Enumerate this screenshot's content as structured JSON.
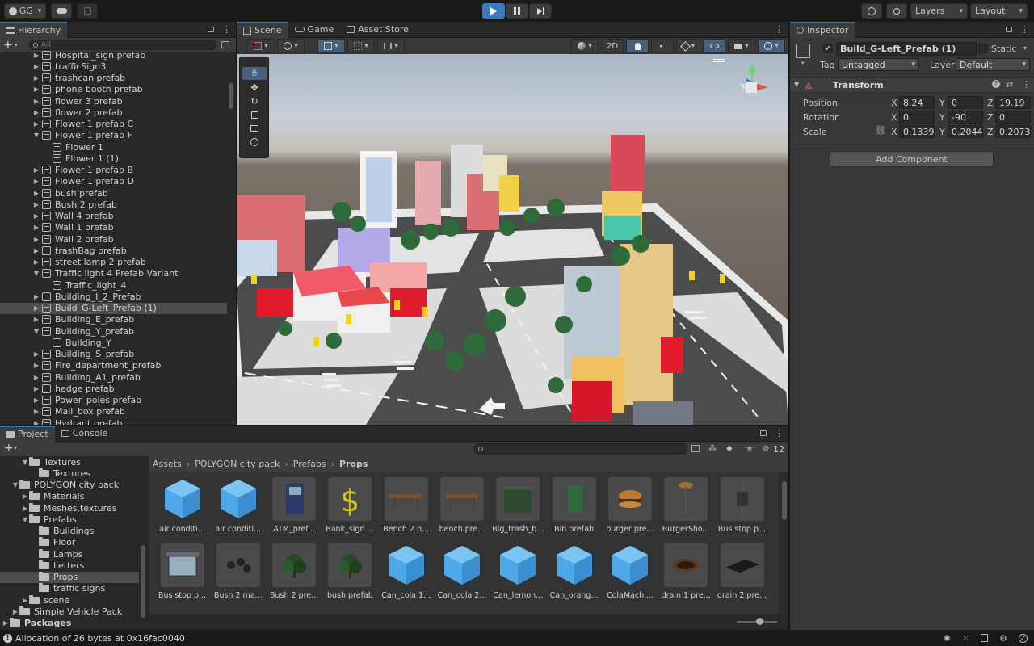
{
  "toolbar": {
    "account": "GG",
    "layers_label": "Layers",
    "layout_label": "Layout"
  },
  "hierarchy": {
    "tab": "Hierarchy",
    "search_placeholder": "All",
    "items": [
      {
        "label": "Hospital_sign prefab",
        "indent": 0,
        "arrow": "▶"
      },
      {
        "label": "trafficSign3",
        "indent": 0,
        "arrow": "▶"
      },
      {
        "label": "trashcan prefab",
        "indent": 0,
        "arrow": "▶"
      },
      {
        "label": "phone booth prefab",
        "indent": 0,
        "arrow": "▶"
      },
      {
        "label": "flower 3 prefab",
        "indent": 0,
        "arrow": "▶"
      },
      {
        "label": "flower 2 prefab",
        "indent": 0,
        "arrow": "▶"
      },
      {
        "label": "Flower 1 prefab C",
        "indent": 0,
        "arrow": "▶"
      },
      {
        "label": "Flower 1 prefab F",
        "indent": 0,
        "arrow": "▼"
      },
      {
        "label": "Flower 1",
        "indent": 1,
        "arrow": ""
      },
      {
        "label": "Flower 1 (1)",
        "indent": 1,
        "arrow": ""
      },
      {
        "label": "Flower 1 prefab B",
        "indent": 0,
        "arrow": "▶"
      },
      {
        "label": "Flower 1 prefab D",
        "indent": 0,
        "arrow": "▶"
      },
      {
        "label": "bush prefab",
        "indent": 0,
        "arrow": "▶"
      },
      {
        "label": "Bush 2 prefab",
        "indent": 0,
        "arrow": "▶"
      },
      {
        "label": "Wall 4 prefab",
        "indent": 0,
        "arrow": "▶"
      },
      {
        "label": "Wall 1 prefab",
        "indent": 0,
        "arrow": "▶"
      },
      {
        "label": "Wall 2 prefab",
        "indent": 0,
        "arrow": "▶"
      },
      {
        "label": "trashBag prefab",
        "indent": 0,
        "arrow": "▶"
      },
      {
        "label": "street lamp 2 prefab",
        "indent": 0,
        "arrow": "▶"
      },
      {
        "label": "Traffic light 4 Prefab Variant",
        "indent": 0,
        "arrow": "▼"
      },
      {
        "label": "Traffic_light_4",
        "indent": 1,
        "arrow": ""
      },
      {
        "label": "Building_I_2_Prefab",
        "indent": 0,
        "arrow": "▶"
      },
      {
        "label": "Build_G-Left_Prefab (1)",
        "indent": 0,
        "arrow": "▶",
        "selected": true
      },
      {
        "label": "Building_E_prefab",
        "indent": 0,
        "arrow": "▶"
      },
      {
        "label": "Building_Y_prefab",
        "indent": 0,
        "arrow": "▼"
      },
      {
        "label": "Building_Y",
        "indent": 1,
        "arrow": ""
      },
      {
        "label": "Building_S_prefab",
        "indent": 0,
        "arrow": "▶"
      },
      {
        "label": "Fire_department_prefab",
        "indent": 0,
        "arrow": "▶"
      },
      {
        "label": "Building_A1_prefab",
        "indent": 0,
        "arrow": "▶"
      },
      {
        "label": "hedge prefab",
        "indent": 0,
        "arrow": "▶"
      },
      {
        "label": "Power_poles prefab",
        "indent": 0,
        "arrow": "▶"
      },
      {
        "label": "Mail_box prefab",
        "indent": 0,
        "arrow": "▶"
      },
      {
        "label": "Hydrant prefab",
        "indent": 0,
        "arrow": "▶"
      }
    ]
  },
  "scene": {
    "tabs": [
      "Scene",
      "Game",
      "Asset Store"
    ],
    "mode_2d": "2D"
  },
  "inspector": {
    "tab": "Inspector",
    "object_name": "Build_G-Left_Prefab (1)",
    "static_label": "Static",
    "tag_label": "Tag",
    "tag_value": "Untagged",
    "layer_label": "Layer",
    "layer_value": "Default",
    "component": "Transform",
    "position_label": "Position",
    "rotation_label": "Rotation",
    "scale_label": "Scale",
    "position": {
      "x": "8.24",
      "y": "0",
      "z": "19.19"
    },
    "rotation": {
      "x": "0",
      "y": "-90",
      "z": "0"
    },
    "scale": {
      "x": "0.1339",
      "y": "0.2044",
      "z": "0.2073"
    },
    "add_component": "Add Component"
  },
  "project": {
    "tabs": [
      "Project",
      "Console"
    ],
    "hidden_count": "12",
    "breadcrumb": [
      "Assets",
      "POLYGON city pack",
      "Prefabs",
      "Props"
    ],
    "tree": [
      {
        "label": "Textures",
        "indent": 1,
        "arrow": "▼"
      },
      {
        "label": "Textures",
        "indent": 2,
        "arrow": ""
      },
      {
        "label": "POLYGON city pack",
        "indent": 0,
        "arrow": "▼"
      },
      {
        "label": "Materials",
        "indent": 1,
        "arrow": "▶"
      },
      {
        "label": "Meshes,textures",
        "indent": 1,
        "arrow": "▶"
      },
      {
        "label": "Prefabs",
        "indent": 1,
        "arrow": "▼"
      },
      {
        "label": "Buildings",
        "indent": 2,
        "arrow": ""
      },
      {
        "label": "Floor",
        "indent": 2,
        "arrow": ""
      },
      {
        "label": "Lamps",
        "indent": 2,
        "arrow": ""
      },
      {
        "label": "Letters",
        "indent": 2,
        "arrow": ""
      },
      {
        "label": "Props",
        "indent": 2,
        "arrow": "",
        "selected": true
      },
      {
        "label": "traffic signs",
        "indent": 2,
        "arrow": ""
      },
      {
        "label": "scene",
        "indent": 1,
        "arrow": "▶"
      },
      {
        "label": "Simple Vehicle Pack",
        "indent": 0,
        "arrow": "▶"
      },
      {
        "label": "Packages",
        "indent": -1,
        "arrow": "▶",
        "bold": true
      }
    ],
    "assets_row1": [
      {
        "label": "air conditi...",
        "thumb": "bluecube"
      },
      {
        "label": "air conditi...",
        "thumb": "bluecube"
      },
      {
        "label": "ATM_pref...",
        "thumb": "atm"
      },
      {
        "label": "Bank_sign ...",
        "thumb": "dollar"
      },
      {
        "label": "Bench 2 p...",
        "thumb": "bench"
      },
      {
        "label": "bench pre...",
        "thumb": "bench"
      },
      {
        "label": "Big_trash_b...",
        "thumb": "trash"
      },
      {
        "label": "Bin prefab",
        "thumb": "bin"
      },
      {
        "label": "burger pre...",
        "thumb": "burger"
      },
      {
        "label": "BurgerSho...",
        "thumb": "pole"
      },
      {
        "label": "Bus stop p...",
        "thumb": "sign"
      }
    ],
    "assets_row2": [
      {
        "label": "Bus stop p...",
        "thumb": "busstop"
      },
      {
        "label": "Bush 2 ma...",
        "thumb": "dots"
      },
      {
        "label": "Bush 2 pre...",
        "thumb": "bush"
      },
      {
        "label": "bush prefab",
        "thumb": "bush"
      },
      {
        "label": "Can_cola 1...",
        "thumb": "bluecube"
      },
      {
        "label": "Can_cola 2...",
        "thumb": "bluecube"
      },
      {
        "label": "Can_lemon...",
        "thumb": "bluecube"
      },
      {
        "label": "Can_orang...",
        "thumb": "bluecube"
      },
      {
        "label": "ColaMachi...",
        "thumb": "bluecube"
      },
      {
        "label": "drain 1 pre...",
        "thumb": "drain"
      },
      {
        "label": "drain 2 pre...",
        "thumb": "drain2"
      }
    ]
  },
  "status": {
    "message": "Allocation of 26 bytes at 0x16fac0040"
  }
}
